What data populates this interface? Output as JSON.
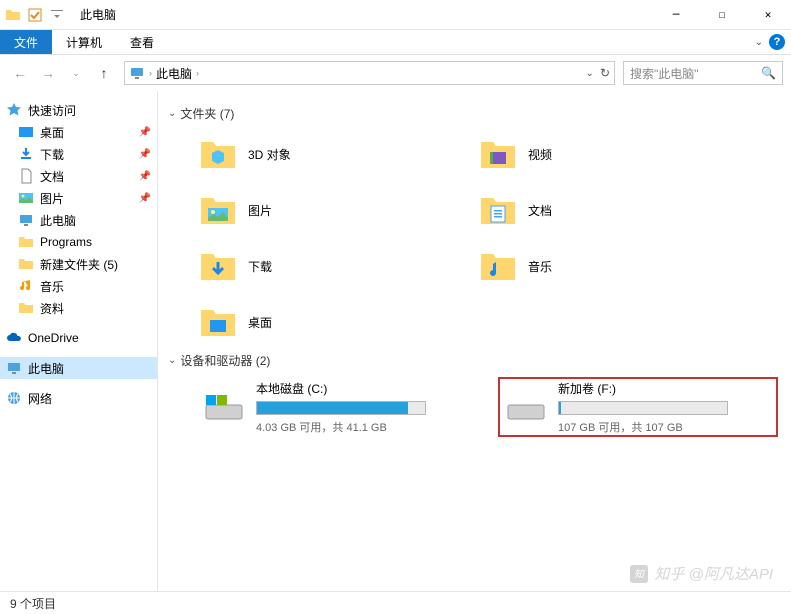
{
  "title": "此电脑",
  "ribbon": {
    "tabs": [
      "文件",
      "计算机",
      "查看"
    ],
    "active_index": 0
  },
  "nav": {
    "address": "此电脑",
    "search_placeholder": "搜索\"此电脑\""
  },
  "sidebar": {
    "quick_access": "快速访问",
    "items": [
      {
        "label": "桌面",
        "pinned": true
      },
      {
        "label": "下载",
        "pinned": true
      },
      {
        "label": "文档",
        "pinned": true
      },
      {
        "label": "图片",
        "pinned": true
      },
      {
        "label": "此电脑",
        "pinned": false
      },
      {
        "label": "Programs",
        "pinned": false
      },
      {
        "label": "新建文件夹 (5)",
        "pinned": false
      },
      {
        "label": "音乐",
        "pinned": false
      },
      {
        "label": "资料",
        "pinned": false
      }
    ],
    "onedrive": "OneDrive",
    "this_pc": "此电脑",
    "network": "网络"
  },
  "content": {
    "folders_header": "文件夹 (7)",
    "folders": [
      {
        "label": "3D 对象"
      },
      {
        "label": "视频"
      },
      {
        "label": "图片"
      },
      {
        "label": "文档"
      },
      {
        "label": "下载"
      },
      {
        "label": "音乐"
      },
      {
        "label": "桌面"
      }
    ],
    "drives_header": "设备和驱动器 (2)",
    "drives": [
      {
        "name": "本地磁盘 (C:)",
        "status": "4.03 GB 可用，共 41.1 GB",
        "fill_pct": 90,
        "highlighted": false
      },
      {
        "name": "新加卷 (F:)",
        "status": "107 GB 可用，共 107 GB",
        "fill_pct": 1,
        "highlighted": true
      }
    ]
  },
  "status": "9 个项目",
  "watermark": "知乎 @阿凡达API"
}
